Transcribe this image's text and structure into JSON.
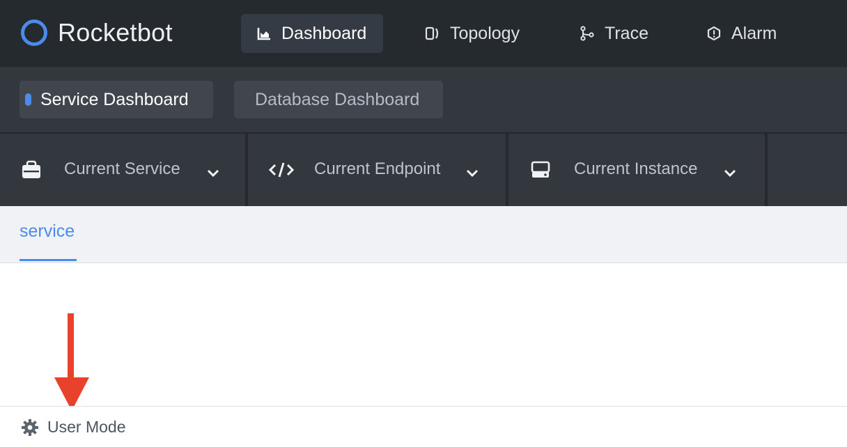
{
  "app": {
    "title": "Rocketbot"
  },
  "nav": {
    "items": [
      {
        "label": "Dashboard",
        "icon": "chart-icon",
        "active": true
      },
      {
        "label": "Topology",
        "icon": "topology-icon",
        "active": false
      },
      {
        "label": "Trace",
        "icon": "trace-icon",
        "active": false
      },
      {
        "label": "Alarm",
        "icon": "alarm-icon",
        "active": false
      }
    ]
  },
  "dashboards": {
    "tabs": [
      {
        "label": "Service Dashboard",
        "active": true
      },
      {
        "label": "Database Dashboard",
        "active": false
      }
    ]
  },
  "selectors": [
    {
      "label": "Current Service",
      "icon": "service-icon"
    },
    {
      "label": "Current Endpoint",
      "icon": "code-icon"
    },
    {
      "label": "Current Instance",
      "icon": "instance-icon"
    }
  ],
  "subtabs": [
    {
      "label": "service",
      "active": true
    }
  ],
  "footer": {
    "user_mode": "User Mode",
    "icon": "gear-icon"
  },
  "colors": {
    "accent": "#4a8bec",
    "topbar": "#252a2f",
    "annotation_arrow": "#e8422d"
  }
}
